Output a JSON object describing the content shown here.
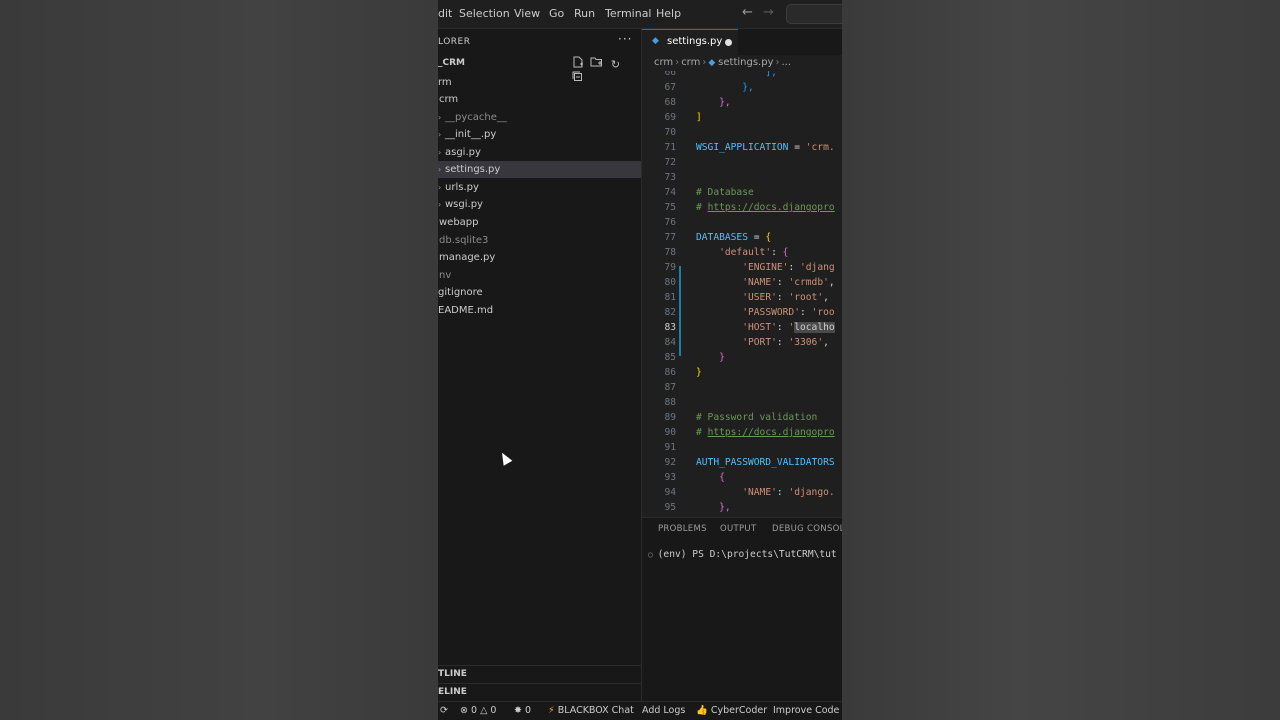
{
  "menubar": {
    "items": [
      "dit",
      "Selection",
      "View",
      "Go",
      "Run",
      "Terminal",
      "Help"
    ]
  },
  "sidebar": {
    "title": "LORER",
    "more": "···",
    "project": "_CRM",
    "tree": [
      {
        "label": "rm"
      },
      {
        "label": "crm"
      },
      {
        "label": "__pycache__",
        "dim": true
      },
      {
        "label": "__init__.py"
      },
      {
        "label": "asgi.py"
      },
      {
        "label": "settings.py",
        "selected": true
      },
      {
        "label": "urls.py"
      },
      {
        "label": "wsgi.py"
      },
      {
        "label": "webapp"
      },
      {
        "label": "db.sqlite3",
        "dim": true
      },
      {
        "label": "manage.py"
      },
      {
        "label": "nv",
        "dim": true
      },
      {
        "label": "gitignore"
      },
      {
        "label": "EADME.md"
      }
    ],
    "outline": "TLINE",
    "timeline": "ELINE"
  },
  "editor": {
    "tab_label": "settings.py",
    "breadcrumb": [
      "crm",
      "crm",
      "settings.py",
      "..."
    ],
    "active_line": "83"
  },
  "code_lines": [
    {
      "n": "66",
      "t": [
        {
          "c": "t-b3",
          "s": "            ],"
        }
      ]
    },
    {
      "n": "67",
      "t": [
        {
          "c": "t-b3",
          "s": "        },"
        }
      ]
    },
    {
      "n": "68",
      "t": [
        {
          "c": "t-b2",
          "s": "    },"
        }
      ]
    },
    {
      "n": "69",
      "t": [
        {
          "c": "t-b1",
          "s": "]"
        }
      ]
    },
    {
      "n": "70",
      "t": []
    },
    {
      "n": "71",
      "t": [
        {
          "c": "t-var",
          "s": "WSGI_APPLICATION"
        },
        {
          "c": "t-op",
          "s": " = "
        },
        {
          "c": "t-str",
          "s": "'crm."
        }
      ]
    },
    {
      "n": "72",
      "t": []
    },
    {
      "n": "73",
      "t": []
    },
    {
      "n": "74",
      "t": [
        {
          "c": "t-com",
          "s": "# Database"
        }
      ]
    },
    {
      "n": "75",
      "t": [
        {
          "c": "t-com",
          "s": "# "
        },
        {
          "c": "t-link",
          "s": "https://docs.djangopro"
        }
      ]
    },
    {
      "n": "76",
      "t": []
    },
    {
      "n": "77",
      "t": [
        {
          "c": "t-var",
          "s": "DATABASES"
        },
        {
          "c": "t-op",
          "s": " = "
        },
        {
          "c": "t-b1",
          "s": "{"
        }
      ]
    },
    {
      "n": "78",
      "t": [
        {
          "c": "t-op",
          "s": "    "
        },
        {
          "c": "t-str",
          "s": "'default'"
        },
        {
          "c": "t-op",
          "s": ": "
        },
        {
          "c": "t-b2",
          "s": "{"
        }
      ]
    },
    {
      "n": "79",
      "t": [
        {
          "c": "t-op",
          "s": "        "
        },
        {
          "c": "t-str",
          "s": "'ENGINE'"
        },
        {
          "c": "t-op",
          "s": ": "
        },
        {
          "c": "t-str",
          "s": "'djang"
        }
      ]
    },
    {
      "n": "80",
      "t": [
        {
          "c": "t-op",
          "s": "        "
        },
        {
          "c": "t-str",
          "s": "'NAME'"
        },
        {
          "c": "t-op",
          "s": ": "
        },
        {
          "c": "t-str",
          "s": "'crmdb'"
        },
        {
          "c": "t-op",
          "s": ","
        }
      ]
    },
    {
      "n": "81",
      "t": [
        {
          "c": "t-op",
          "s": "        "
        },
        {
          "c": "t-str",
          "s": "'USER'"
        },
        {
          "c": "t-op",
          "s": ": "
        },
        {
          "c": "t-str",
          "s": "'root'"
        },
        {
          "c": "t-op",
          "s": ","
        }
      ]
    },
    {
      "n": "82",
      "t": [
        {
          "c": "t-op",
          "s": "        "
        },
        {
          "c": "t-str",
          "s": "'PASSWORD'"
        },
        {
          "c": "t-op",
          "s": ": "
        },
        {
          "c": "t-str",
          "s": "'roo"
        }
      ]
    },
    {
      "n": "83",
      "t": [
        {
          "c": "t-op",
          "s": "        "
        },
        {
          "c": "t-str",
          "s": "'HOST'"
        },
        {
          "c": "t-op",
          "s": ": "
        },
        {
          "c": "t-str",
          "s": "'"
        },
        {
          "c": "t-hl",
          "s": "localho"
        }
      ]
    },
    {
      "n": "84",
      "t": [
        {
          "c": "t-op",
          "s": "        "
        },
        {
          "c": "t-str",
          "s": "'PORT'"
        },
        {
          "c": "t-op",
          "s": ": "
        },
        {
          "c": "t-str",
          "s": "'3306'"
        },
        {
          "c": "t-op",
          "s": ","
        }
      ]
    },
    {
      "n": "85",
      "t": [
        {
          "c": "t-b2",
          "s": "    }"
        }
      ]
    },
    {
      "n": "86",
      "t": [
        {
          "c": "t-b1",
          "s": "}"
        }
      ]
    },
    {
      "n": "87",
      "t": []
    },
    {
      "n": "88",
      "t": []
    },
    {
      "n": "89",
      "t": [
        {
          "c": "t-com",
          "s": "# Password validation"
        }
      ]
    },
    {
      "n": "90",
      "t": [
        {
          "c": "t-com",
          "s": "# "
        },
        {
          "c": "t-link",
          "s": "https://docs.djangopro"
        }
      ]
    },
    {
      "n": "91",
      "t": []
    },
    {
      "n": "92",
      "t": [
        {
          "c": "t-var",
          "s": "AUTH_PASSWORD_VALIDATORS"
        }
      ]
    },
    {
      "n": "93",
      "t": [
        {
          "c": "t-op",
          "s": "    "
        },
        {
          "c": "t-b2",
          "s": "{"
        }
      ]
    },
    {
      "n": "94",
      "t": [
        {
          "c": "t-op",
          "s": "        "
        },
        {
          "c": "t-str",
          "s": "'NAME'"
        },
        {
          "c": "t-op",
          "s": ": "
        },
        {
          "c": "t-str",
          "s": "'django."
        }
      ]
    },
    {
      "n": "95",
      "t": [
        {
          "c": "t-b2",
          "s": "    },"
        }
      ]
    }
  ],
  "panel": {
    "tabs": [
      "PROBLEMS",
      "OUTPUT",
      "DEBUG CONSOLE"
    ],
    "terminal_line": "(env) PS D:\\projects\\TutCRM\\tut"
  },
  "statusbar": {
    "errors": "0",
    "warnings": "0",
    "ports": "0",
    "blackbox": "BLACKBOX Chat",
    "add_logs": "Add Logs",
    "cybercoder": "CyberCoder",
    "improve": "Improve Code"
  }
}
